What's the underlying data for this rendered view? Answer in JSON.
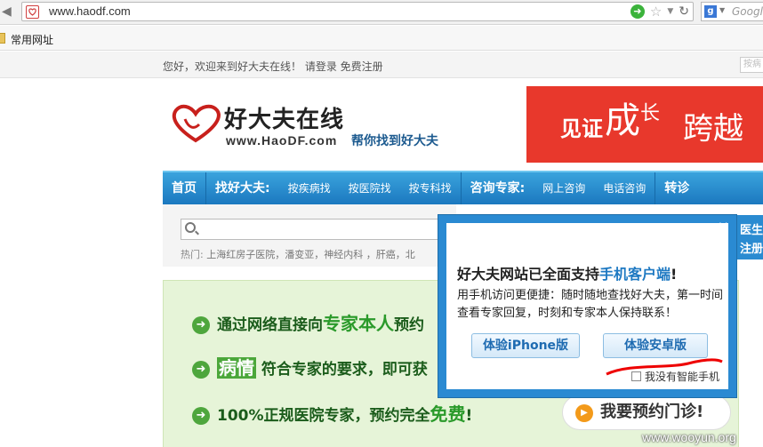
{
  "browser": {
    "url": "www.haodf.com",
    "search_placeholder": "Google",
    "bookmark_label": "常用网址"
  },
  "site": {
    "welcome": "您好，欢迎来到好大夫在线！ 请登录  免费注册",
    "topbar_search": "按病",
    "logo_cn": "好大夫在线",
    "logo_url": "www.HaoDF.com",
    "slogan": "帮你找到好大夫",
    "banner": {
      "a": "见证",
      "b": "成",
      "b_sup": "长",
      "c": "跨越"
    }
  },
  "nav": {
    "items": [
      "首页",
      "找好大夫:",
      "按疾病找",
      "按医院找",
      "按专科找",
      "咨询专家:",
      "网上咨询",
      "电话咨询",
      "转诊"
    ]
  },
  "search": {
    "hot_label": "热门:",
    "hot_links": "上海红房子医院，潘变亚，神经内科 ，肝癌，北"
  },
  "right_blue": {
    "line1": "医生",
    "line2": "注册"
  },
  "promo": {
    "row1_a": "通过网络直接向",
    "row1_em": "专家本人",
    "row1_b": "预约",
    "row2_em": "病情",
    "row2_b": "符合专家的要求，即可获",
    "row3_a": "100%正规医院专家，预约完全",
    "row3_em": "免费",
    "row3_b": "!",
    "book_button": "我要预约门诊!"
  },
  "popup": {
    "close": "×",
    "title_a": "好大夫网站已全面支持",
    "title_hl": "手机客户端",
    "title_b": "!",
    "desc": "用手机访问更便捷：随时随地查找好大夫，第一时间查看专家回复，时刻和专家本人保持联系！",
    "btn_iphone": "体验iPhone版",
    "btn_android": "体验安卓版",
    "no_smart": "我没有智能手机"
  },
  "watermark": "www.wooyun.org"
}
